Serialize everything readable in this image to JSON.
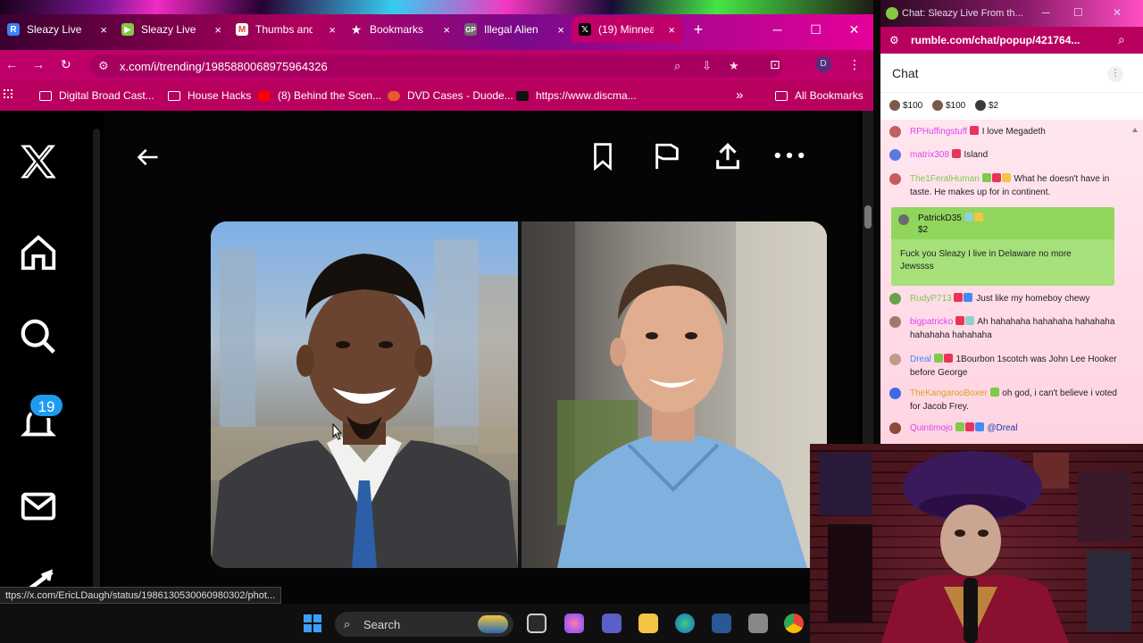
{
  "browser": {
    "tabs": [
      {
        "label": "Sleazy Live f",
        "icon": "rumble-icon",
        "color": "#3b82f6"
      },
      {
        "label": "Sleazy Live F",
        "icon": "rumble-play-icon",
        "color": "#85c742"
      },
      {
        "label": "Thumbs and",
        "icon": "gmail-icon",
        "color": "#ea4335"
      },
      {
        "label": "Bookmarks",
        "icon": "star-icon",
        "color": "#ffffff"
      },
      {
        "label": "Illegal Alien",
        "icon": "gp-icon",
        "color": "#6d6d6d"
      },
      {
        "label": "(19) Minnea",
        "icon": "x-logo-icon",
        "color": "#000000"
      }
    ],
    "new_tab": "+",
    "close_glyph": "×",
    "url": "x.com/i/trending/1985880068975964326",
    "profile_initial": "D",
    "bookmarks": [
      {
        "label": "Digital Broad Cast...",
        "icon": "folder-icon"
      },
      {
        "label": "House Hacks",
        "icon": "folder-icon"
      },
      {
        "label": "(8) Behind the Scen...",
        "icon": "youtube-icon"
      },
      {
        "label": "DVD Cases - Duode...",
        "icon": "dvd-icon"
      },
      {
        "label": "https://www.discma...",
        "icon": "discmakers-icon"
      }
    ],
    "all_bookmarks": "All Bookmarks",
    "more_bookmarks": "»",
    "status_url": "ttps://x.com/EricLDaugh/status/1986130530060980302/phot..."
  },
  "x": {
    "notifications_count": "19",
    "icons": [
      "x-logo-icon",
      "home-icon",
      "search-icon",
      "bell-icon",
      "mail-icon"
    ]
  },
  "chat": {
    "window_title": "Chat: Sleazy Live From th...",
    "url": "rumble.com/chat/popup/421764...",
    "header": "Chat",
    "tips": [
      "$100",
      "$100",
      "$2"
    ],
    "messages": [
      {
        "user": "RPHuffingstuff",
        "color": "#d946ef",
        "text": "I love Megadeth",
        "avatar": "#c06060"
      },
      {
        "user": "matrix308",
        "color": "#d946ef",
        "text": "Island",
        "avatar": "#5a7ae0"
      },
      {
        "user": "The1FeralHuman",
        "color": "#7ccb4b",
        "text": "What he doesn't have in taste. He makes up for in continent.",
        "avatar": "#c85a5a"
      },
      {
        "user": "RudyP713",
        "color": "#7ccb4b",
        "text": "Just like my homeboy chewy",
        "avatar": "#6aa04a"
      },
      {
        "user": "bigpatricko",
        "color": "#d946ef",
        "text": "Ah hahahaha hahahaha hahahaha hahahaha hahahaha",
        "avatar": "#a07a6a"
      },
      {
        "user": "Dreal",
        "color": "#3f8cf2",
        "text": "1Bourbon 1scotch was John Lee Hooker before George",
        "avatar": "#c09a8a"
      },
      {
        "user": "TheKangarooBoxer",
        "color": "#e0a020",
        "text": "oh god, i can't believe i voted for Jacob Frey.",
        "avatar": "#3f6ae0"
      },
      {
        "user": "Quintimojo",
        "color": "#d946ef",
        "text": "@Dreal",
        "avatar": "#8a4a3a"
      }
    ],
    "highlight": {
      "user": "PatrickD35",
      "amount": "$2",
      "text": "Fuck you Sleazy I live in Delaware no more Jewssss"
    }
  },
  "taskbar": {
    "search_label": "Search"
  }
}
